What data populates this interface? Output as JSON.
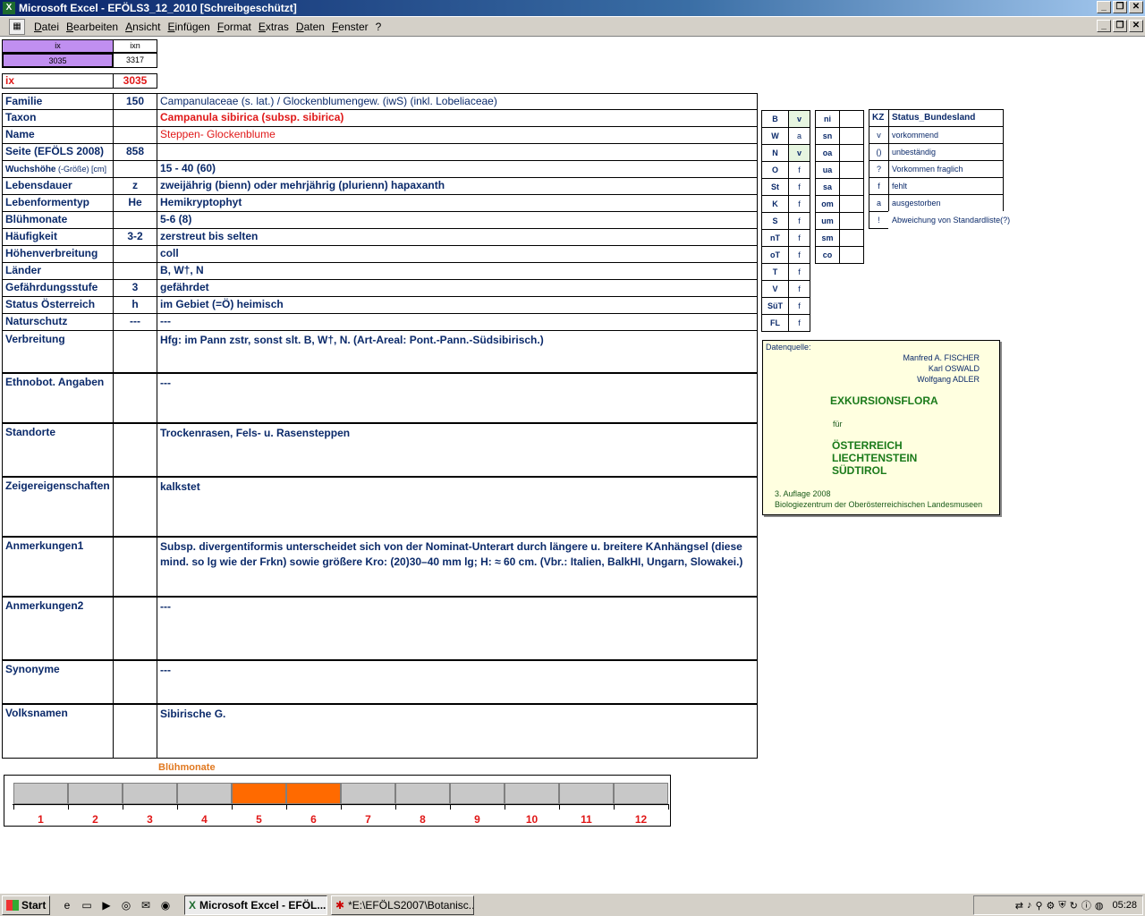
{
  "window": {
    "title": "Microsoft Excel - EFÖLS3_12_2010  [Schreibgeschützt]"
  },
  "menu": [
    "Datei",
    "Bearbeiten",
    "Ansicht",
    "Einfügen",
    "Format",
    "Extras",
    "Daten",
    "Fenster",
    "?"
  ],
  "index": {
    "ix_label": "ix",
    "ixn_label": "ixn",
    "ix_value": "3035",
    "ixn_value": "3317",
    "ix_big_label": "ix",
    "ix_big_value": "3035"
  },
  "rows": [
    {
      "label": "Familie",
      "code": "150",
      "value": "Campanulaceae (s. lat.)  /  Glockenblumengew. (iwS) (inkl. Lobeliaceae)"
    },
    {
      "label": "Taxon",
      "code": "",
      "value": "Campanula sibirica (subsp. sibirica)"
    },
    {
      "label": "Name",
      "code": "",
      "value": "Steppen- Glockenblume"
    },
    {
      "label": "Seite (EFÖLS 2008)",
      "code": "858",
      "value": ""
    },
    {
      "label": "Wuchshöhe",
      "label_suffix": " (-Größe) [cm]",
      "code": "",
      "value": " 15 - 40 (60)"
    },
    {
      "label": "Lebensdauer",
      "code": "z",
      "value": "zweijährig (bienn) oder mehrjährig (plurienn) hapaxanth"
    },
    {
      "label": "Lebenformentyp",
      "code": "He",
      "value": "Hemikryptophyt"
    },
    {
      "label": "Blühmonate",
      "code": "",
      "value": " 5-6 (8)"
    },
    {
      "label": "Häufigkeit",
      "code": "3-2",
      "value": "zerstreut bis selten"
    },
    {
      "label": "Höhenverbreitung",
      "code": "",
      "value": "coll"
    },
    {
      "label": "Länder",
      "code": "",
      "value": "B, W†, N"
    },
    {
      "label": "Gefährdungsstufe",
      "code": "3",
      "value": "gefährdet"
    },
    {
      "label": "Status Österreich",
      "code": "h",
      "value": "im Gebiet (=Ö) heimisch"
    },
    {
      "label": "Naturschutz",
      "code": "---",
      "value": " ---"
    }
  ],
  "big_rows": [
    {
      "label": "Verbreitung",
      "value": "Hfg:  im Pann zstr, sonst slt. B, W†, N. (Art-Areal: Pont.-Pann.-Südsibirisch.)",
      "value2": ""
    },
    {
      "label": "Ethnobot. Angaben",
      "value": "---",
      "value2": ""
    },
    {
      "label": "Standorte",
      "value": "Trockenrasen, Fels- u. Rasensteppen",
      "value2": ""
    },
    {
      "label": "Zeigereigenschaften",
      "value": "kalkstet",
      "value2": ""
    },
    {
      "label": "Anmerkungen1",
      "value": "Subsp. divergentiformis unterscheidet sich von der Nominat-Unterart durch längere u. breitere KAnhängsel (diese",
      "value2": "mind. so lg wie der Frkn) sowie größere Kro: (20)30–40 mm lg; H: ≈ 60 cm. (Vbr.: Italien, BalkHI, Ungarn, Slowakei.)"
    },
    {
      "label": "Anmerkungen2",
      "value": "---",
      "value2": ""
    },
    {
      "label": "Synonyme",
      "value": "---",
      "value2": ""
    },
    {
      "label": "Volksnamen",
      "value": "Sibirische G.",
      "value2": ""
    }
  ],
  "regions": [
    {
      "k": "B",
      "v": "v"
    },
    {
      "k": "W",
      "v": "a"
    },
    {
      "k": "N",
      "v": "v"
    },
    {
      "k": "O",
      "v": "f"
    },
    {
      "k": "St",
      "v": "f"
    },
    {
      "k": "K",
      "v": "f"
    },
    {
      "k": "S",
      "v": "f"
    },
    {
      "k": "nT",
      "v": "f"
    },
    {
      "k": "oT",
      "v": "f"
    },
    {
      "k": "T",
      "v": "f"
    },
    {
      "k": "V",
      "v": "f"
    },
    {
      "k": "SüT",
      "v": "f"
    },
    {
      "k": "FL",
      "v": "f"
    }
  ],
  "altitudes": [
    "ni",
    "sn",
    "oa",
    "ua",
    "sa",
    "om",
    "um",
    "sm",
    "co"
  ],
  "status_legend": {
    "kz": "KZ",
    "title": "Status_Bundesland",
    "items": [
      {
        "k": "v",
        "t": "vorkommend"
      },
      {
        "k": "()",
        "t": "unbeständig"
      },
      {
        "k": "?",
        "t": "Vorkommen fraglich"
      },
      {
        "k": "f",
        "t": "fehlt"
      },
      {
        "k": "a",
        "t": "ausgestorben"
      },
      {
        "k": "!",
        "t": "Abweichung von Standardliste(?)"
      }
    ]
  },
  "source": {
    "label": "Datenquelle:",
    "authors": [
      "Manfred A. FISCHER",
      "Karl OSWALD",
      "Wolfgang ADLER"
    ],
    "book": "EXKURSIONSFLORA",
    "fuer": "für",
    "countries": [
      "ÖSTERREICH",
      "LIECHTENSTEIN",
      "SÜDTIROL"
    ],
    "edition": "3. Auflage 2008",
    "publisher": "Biologiezentrum der Oberösterreichischen Landesmuseen"
  },
  "bloom": {
    "title": "Blühmonate",
    "months": [
      "1",
      "2",
      "3",
      "4",
      "5",
      "6",
      "7",
      "8",
      "9",
      "10",
      "11",
      "12"
    ],
    "active": [
      5,
      6
    ],
    "colors": {
      "on": "#ff6a00",
      "off": "#c8c8c8"
    }
  },
  "taskbar": {
    "start": "Start",
    "tasks": [
      "Microsoft Excel - EFÖL...",
      "*E:\\EFÖLS2007\\Botanisc..."
    ],
    "clock": "05:28"
  }
}
